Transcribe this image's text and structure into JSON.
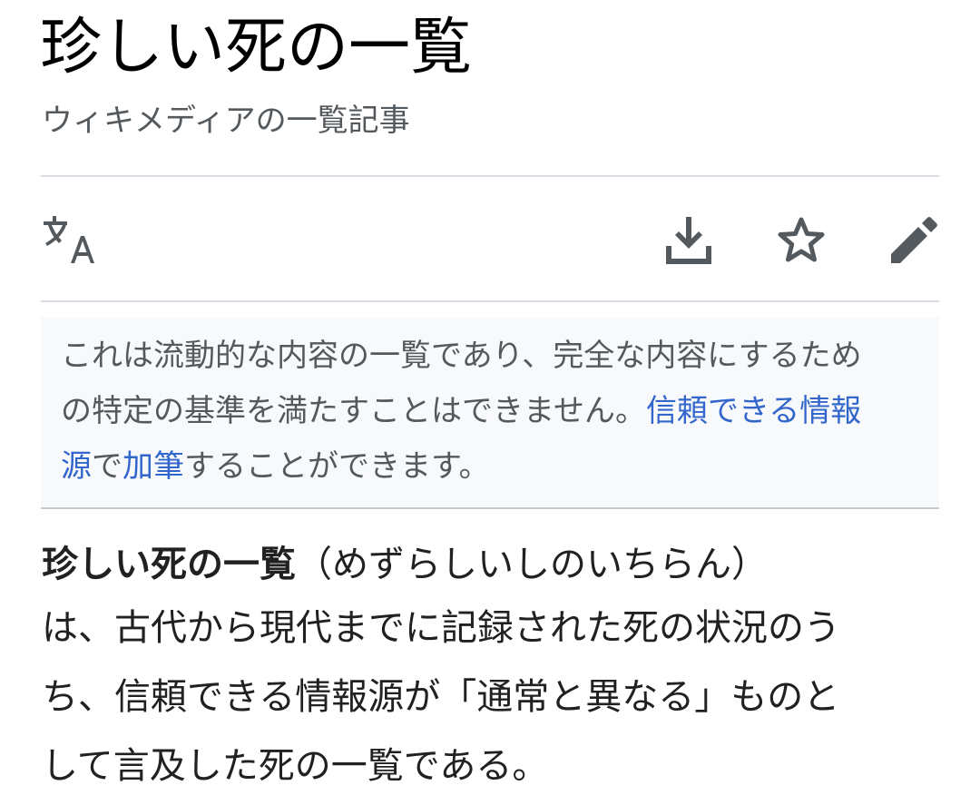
{
  "page": {
    "title": "珍しい死の一覧",
    "subtitle": "ウィキメディアの一覧記事"
  },
  "toolbar": {
    "language_icon": "translate-icon",
    "download_icon": "download-icon",
    "watch_icon": "star-icon",
    "edit_icon": "pencil-icon",
    "icon_color": "#54595d"
  },
  "notice": {
    "line1": "これは流動的な内容の一覧であり、完全な内容にするため",
    "line2_text": "の特定の基準を満たすことはできません。",
    "line2_link": "信頼できる情報",
    "line3_link": "源",
    "line3_text_a": "で",
    "line3_link2": "加筆",
    "line3_text_b": "することができます。",
    "link_color": "#3366cc"
  },
  "article": {
    "term": "珍しい死の一覧",
    "reading": "（めずらしいしのいちらん）",
    "line2": "は、古代から現代までに記録された死の状況のう",
    "line3": "ち、信頼できる情報源が「通常と異なる」ものと",
    "line4": "して言及した死の一覧である。"
  }
}
